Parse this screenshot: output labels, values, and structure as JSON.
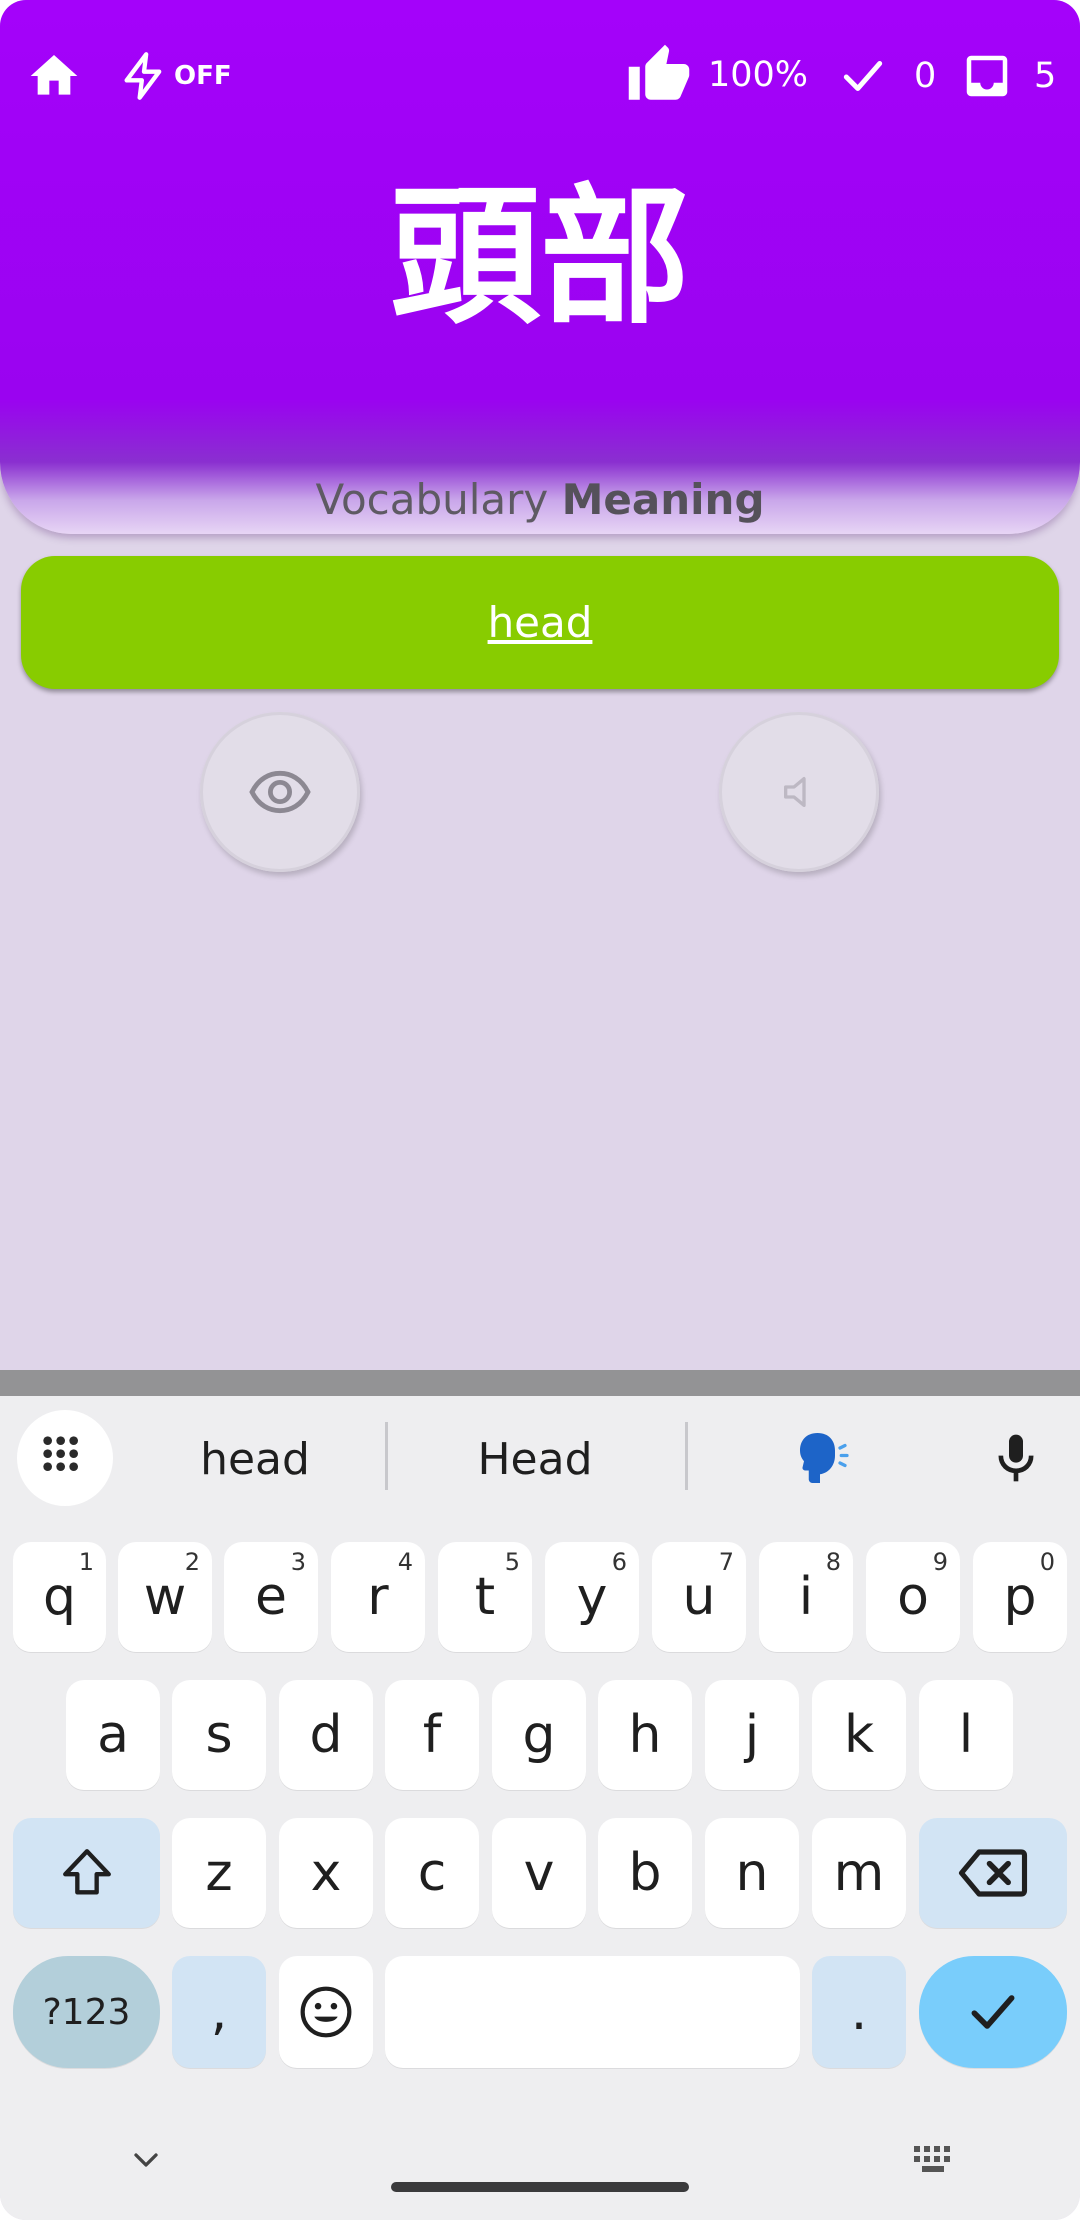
{
  "header": {
    "lightning_status": "OFF",
    "like_percent": "100%",
    "correct_count": "0",
    "inbox_count": "5",
    "word": "頭部",
    "card_label_regular": "Vocabulary",
    "card_label_bold": "Meaning"
  },
  "answer": {
    "text": "head"
  },
  "icons": {
    "home": "home-icon",
    "lightning": "lightning-icon",
    "thumb": "thumbs-up-icon",
    "check": "check-icon",
    "inbox": "inbox-icon",
    "eye": "eye-icon",
    "speaker": "speaker-icon"
  },
  "colors": {
    "header_purple": "#a402fa",
    "answer_green": "#88cc00",
    "background": "#dfd5e9",
    "enter_key": "#79cdfb"
  },
  "keyboard": {
    "suggestions": [
      "head",
      "Head"
    ],
    "row1": [
      {
        "label": "q",
        "hint": "1"
      },
      {
        "label": "w",
        "hint": "2"
      },
      {
        "label": "e",
        "hint": "3"
      },
      {
        "label": "r",
        "hint": "4"
      },
      {
        "label": "t",
        "hint": "5"
      },
      {
        "label": "y",
        "hint": "6"
      },
      {
        "label": "u",
        "hint": "7"
      },
      {
        "label": "i",
        "hint": "8"
      },
      {
        "label": "o",
        "hint": "9"
      },
      {
        "label": "p",
        "hint": "0"
      }
    ],
    "row2": [
      "a",
      "s",
      "d",
      "f",
      "g",
      "h",
      "j",
      "k",
      "l"
    ],
    "row3": [
      "z",
      "x",
      "c",
      "v",
      "b",
      "n",
      "m"
    ],
    "symbols_label": "?123",
    "comma_label": ",",
    "period_label": "."
  }
}
